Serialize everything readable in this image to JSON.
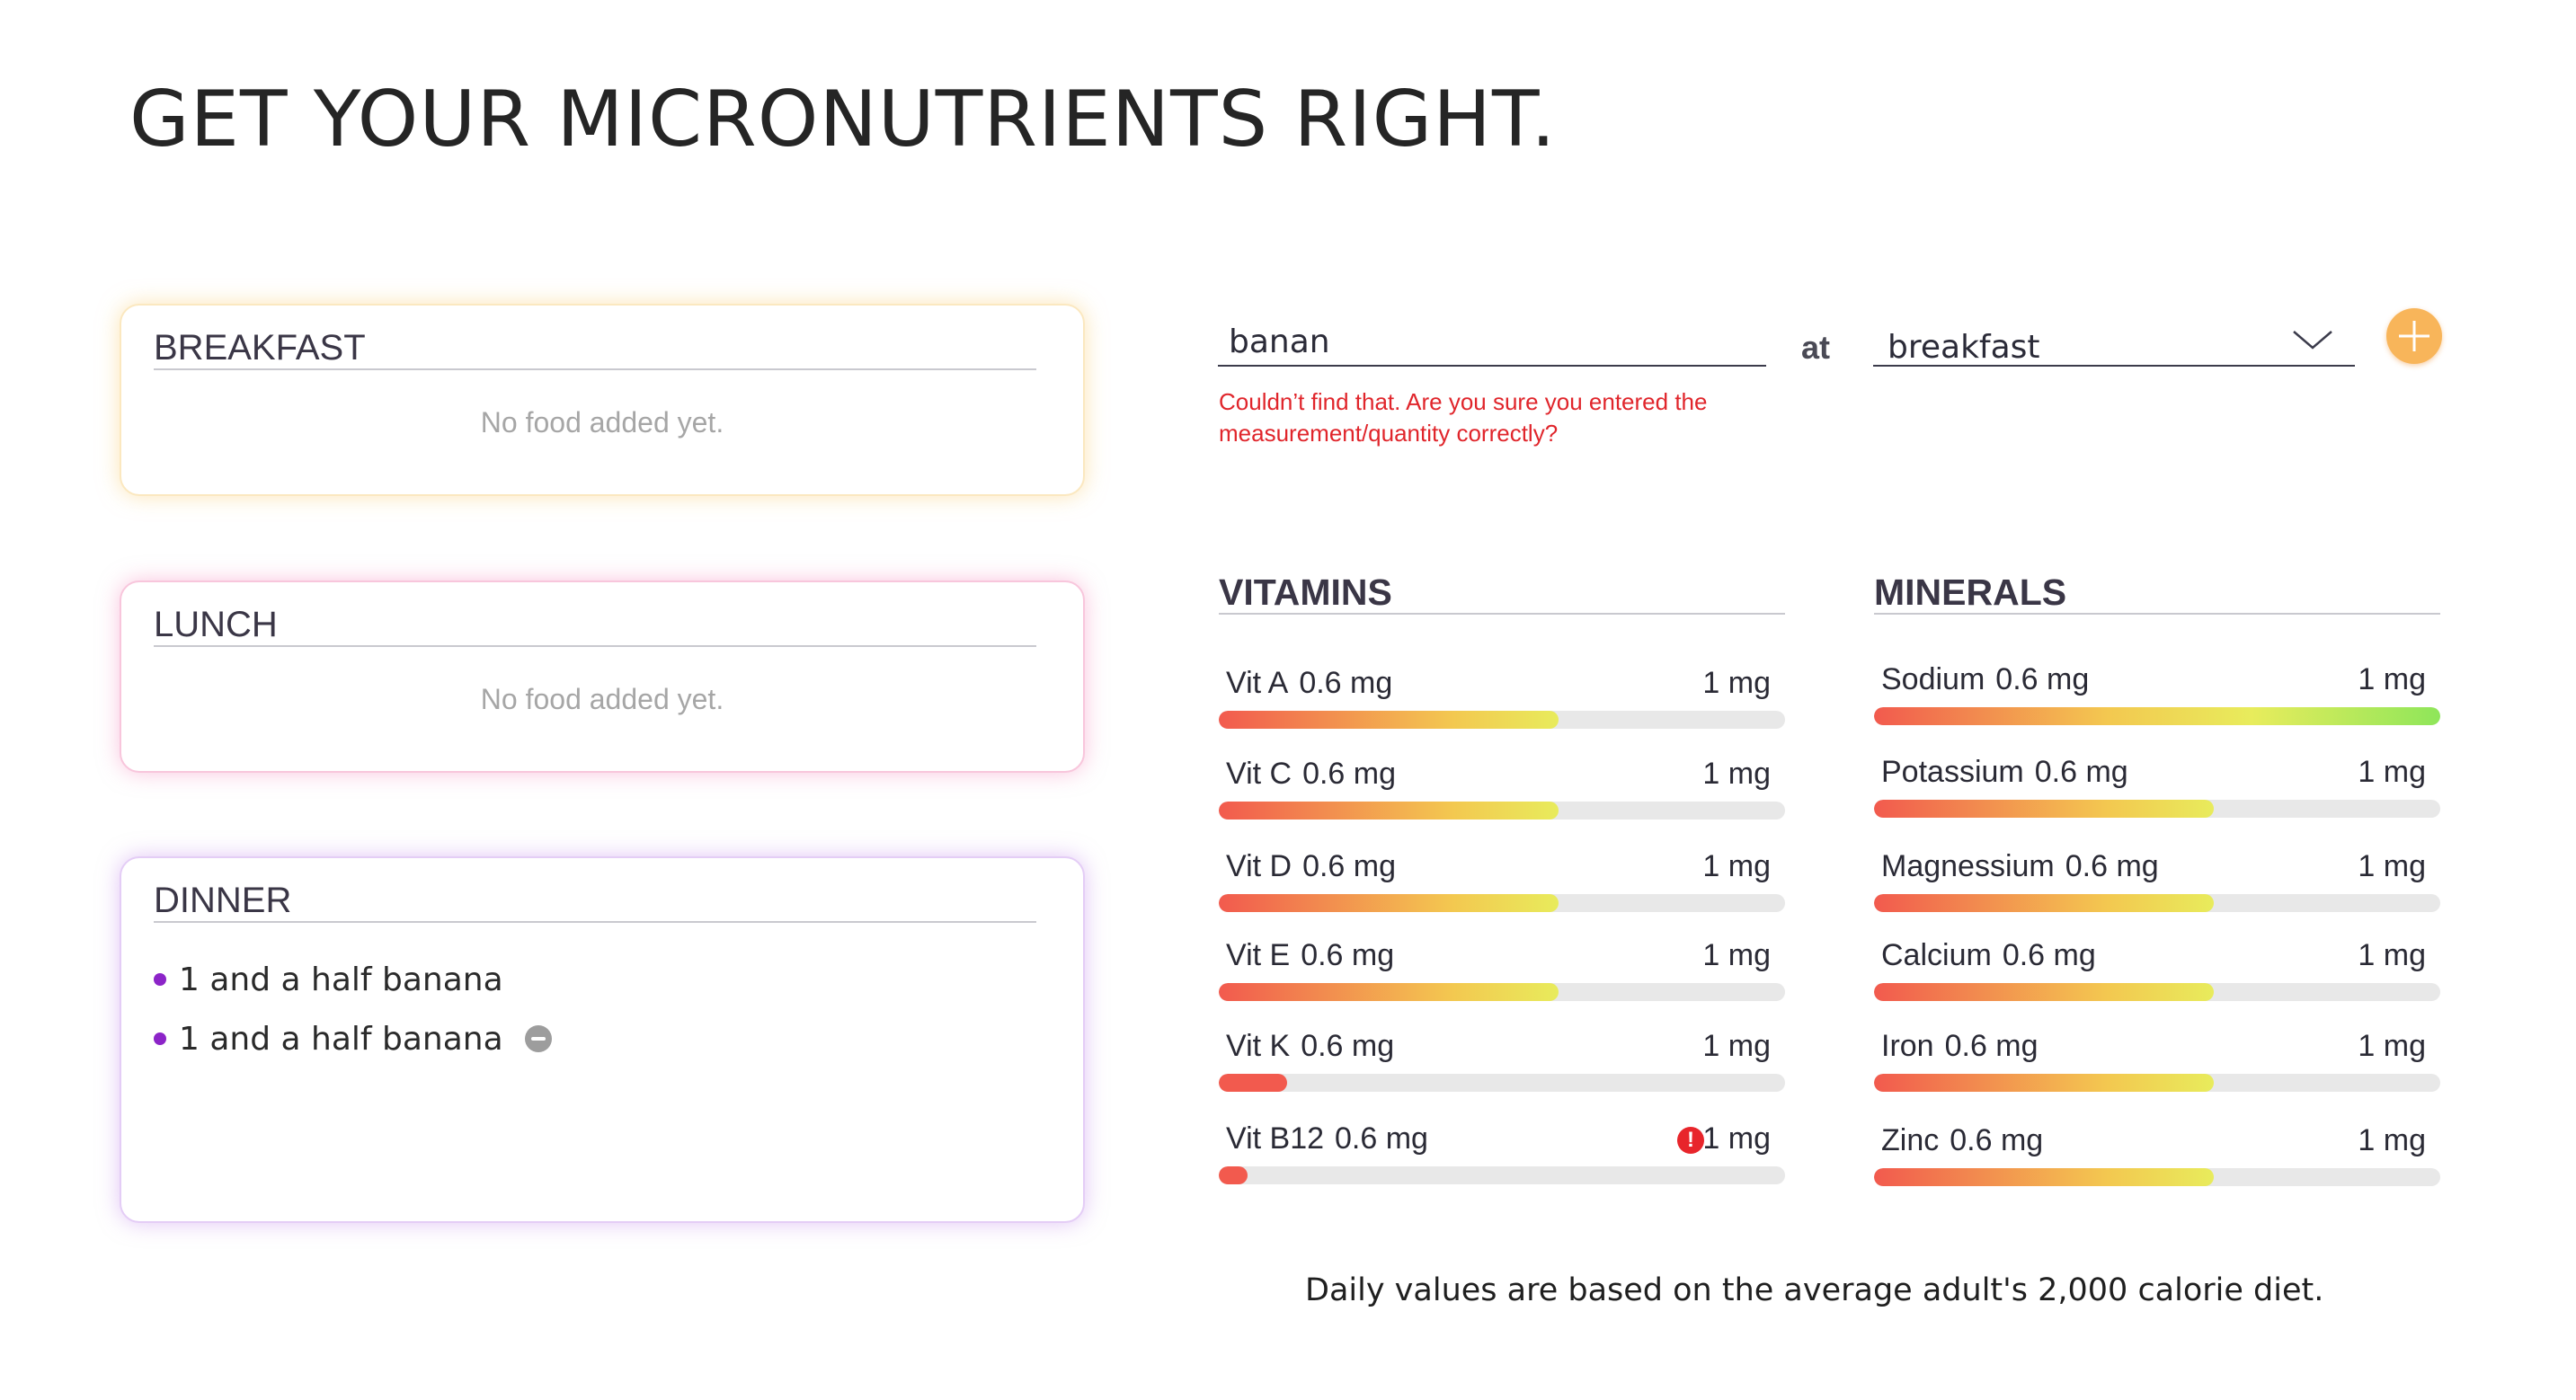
{
  "page": {
    "title": "GET YOUR MICRONUTRIENTS RIGHT."
  },
  "meals": {
    "breakfast": {
      "title": "BREAKFAST",
      "empty_text": "No food added yet."
    },
    "lunch": {
      "title": "LUNCH",
      "empty_text": "No food added yet."
    },
    "dinner": {
      "title": "DINNER",
      "items": [
        {
          "label": "1 and a half banana",
          "removable": false
        },
        {
          "label": "1 and a half banana",
          "removable": true
        }
      ]
    }
  },
  "add_food": {
    "input_value": "banan",
    "at_label": "at",
    "meal_selected": "breakfast",
    "error_message": "Couldn’t find that. Are you sure you entered the measurement/quantity correctly?"
  },
  "colors": {
    "accent_orange": "#f8b55a",
    "bullet_purple": "#8c24c8",
    "error_red": "#e0252b",
    "bar_low": "#f25a4e",
    "bar_mid": "#f3c850",
    "bar_high": "#e8ec5c",
    "bar_full": "#8ee65a"
  },
  "vitamins": {
    "title": "VITAMINS",
    "items": [
      {
        "name": "Vit A",
        "amount": "0.6 mg",
        "goal": "1 mg",
        "progress": 0.6,
        "warning": false
      },
      {
        "name": "Vit C",
        "amount": "0.6 mg",
        "goal": "1 mg",
        "progress": 0.6,
        "warning": false
      },
      {
        "name": "Vit D",
        "amount": "0.6 mg",
        "goal": "1 mg",
        "progress": 0.6,
        "warning": false
      },
      {
        "name": "Vit E",
        "amount": "0.6 mg",
        "goal": "1 mg",
        "progress": 0.6,
        "warning": false
      },
      {
        "name": "Vit K",
        "amount": "0.6 mg",
        "goal": "1 mg",
        "progress": 0.12,
        "warning": false
      },
      {
        "name": "Vit B12",
        "amount": "0.6 mg",
        "goal": "1 mg",
        "progress": 0.05,
        "warning": true
      }
    ]
  },
  "minerals": {
    "title": "MINERALS",
    "items": [
      {
        "name": "Sodium",
        "amount": "0.6 mg",
        "goal": "1 mg",
        "progress": 1.0,
        "warning": false
      },
      {
        "name": "Potassium",
        "amount": "0.6 mg",
        "goal": "1 mg",
        "progress": 0.6,
        "warning": false
      },
      {
        "name": "Magnessium",
        "amount": "0.6 mg",
        "goal": "1 mg",
        "progress": 0.6,
        "warning": false
      },
      {
        "name": "Calcium",
        "amount": "0.6 mg",
        "goal": "1 mg",
        "progress": 0.6,
        "warning": false
      },
      {
        "name": "Iron",
        "amount": "0.6 mg",
        "goal": "1 mg",
        "progress": 0.6,
        "warning": false
      },
      {
        "name": "Zinc",
        "amount": "0.6 mg",
        "goal": "1 mg",
        "progress": 0.6,
        "warning": false
      }
    ]
  },
  "footnote": "Daily values are based on the average adult's 2,000 calorie diet."
}
